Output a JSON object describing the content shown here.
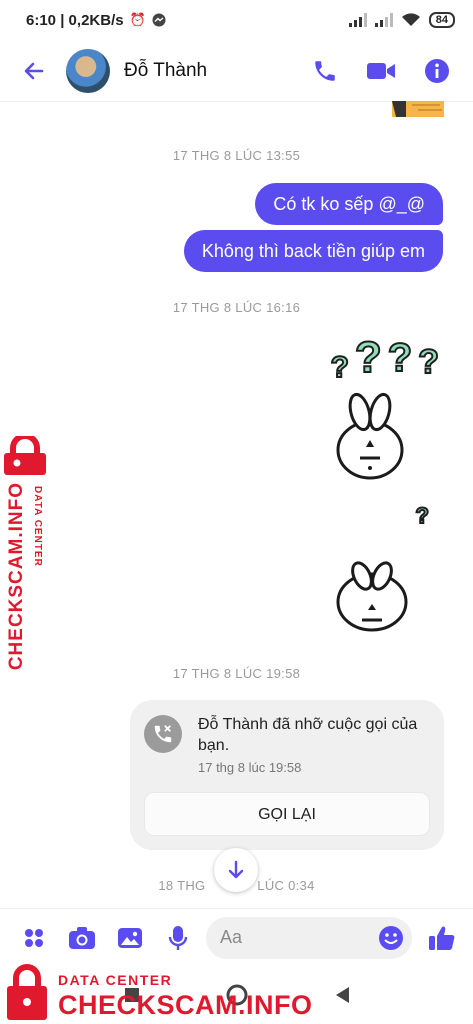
{
  "status_bar": {
    "time_speed": "6:10 | 0,2KB/s",
    "battery": "84"
  },
  "header": {
    "contact_name": "Đỗ Thành"
  },
  "messages": {
    "stamp1": "17 THG 8 LÚC 13:55",
    "sent1": "Có tk ko sếp @_@",
    "sent2": "Không thì back tiền giúp em",
    "stamp2": "17 THG 8 LÚC 16:16",
    "question_marks": [
      "?",
      "?",
      "?",
      "?"
    ],
    "small_question": "?",
    "stamp3": "17 THG 8 LÚC 19:58",
    "stamp4_left": "18 THG",
    "stamp4_right": "LÚC 0:34"
  },
  "missed_call": {
    "title": "Đỗ Thành đã nhỡ cuộc gọi của bạn.",
    "time": "17 thg 8 lúc 19:58",
    "callback_label": "GỌI LẠI"
  },
  "composer": {
    "placeholder": "Aa"
  },
  "watermark": {
    "label_small": "DATA CENTER",
    "label_big": "CHECKSCAM.INFO"
  },
  "colors": {
    "accent": "#5b4cf0",
    "watermark": "#e0192e"
  }
}
